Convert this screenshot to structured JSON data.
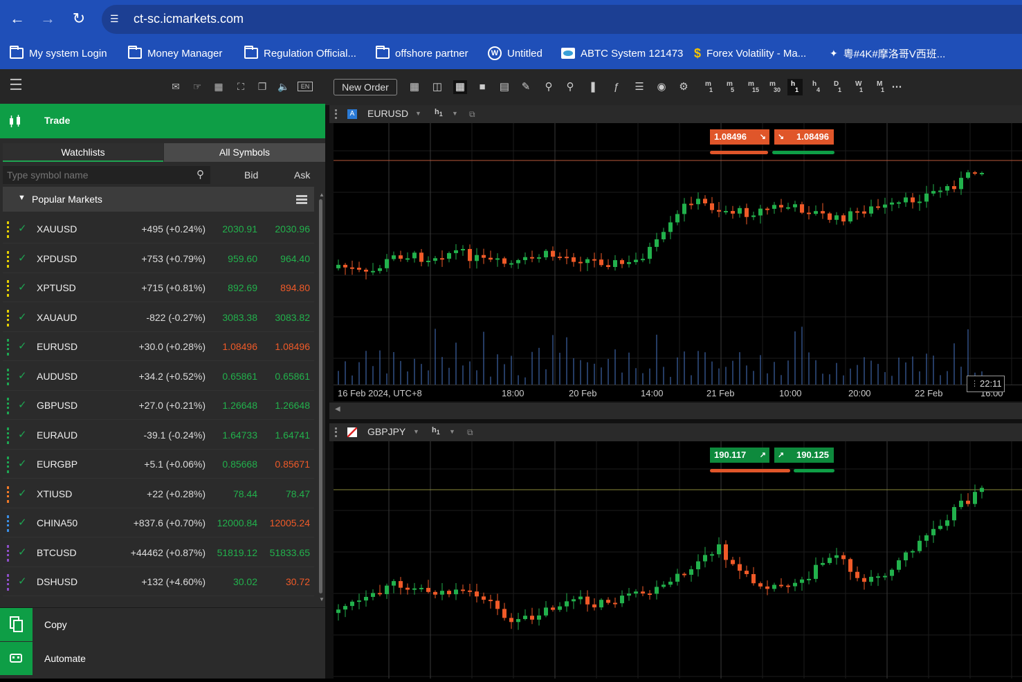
{
  "browser": {
    "url": "ct-sc.icmarkets.com",
    "bookmarks": [
      {
        "label": "My system Login",
        "icon": "folder-icon"
      },
      {
        "label": "Money Manager",
        "icon": "folder-icon"
      },
      {
        "label": "Regulation Official...",
        "icon": "folder-icon"
      },
      {
        "label": "offshore partner",
        "icon": "folder-icon"
      },
      {
        "label": "Untitled",
        "icon": "wordpress-icon"
      },
      {
        "label": "ABTC System 121473",
        "icon": "site-icon"
      },
      {
        "label": "Forex Volatility - Ma...",
        "icon": "dollar-icon"
      },
      {
        "label": "粵#4K#摩洛哥V西班...",
        "icon": "site-icon"
      }
    ]
  },
  "left_panel": {
    "trade_label": "Trade",
    "tabs": [
      "Watchlists",
      "All Symbols"
    ],
    "search_placeholder": "Type symbol name",
    "col_bid": "Bid",
    "col_ask": "Ask",
    "group_label": "Popular Markets",
    "symbols": [
      {
        "sym": "XAUUSD",
        "chg": "+495 (+0.24%)",
        "bid": "2030.91",
        "ask": "2030.96",
        "bid_dir": "up",
        "ask_dir": "up",
        "dot": "#e6d000"
      },
      {
        "sym": "XPDUSD",
        "chg": "+753 (+0.79%)",
        "bid": "959.60",
        "ask": "964.40",
        "bid_dir": "up",
        "ask_dir": "up",
        "dot": "#e6d000"
      },
      {
        "sym": "XPTUSD",
        "chg": "+715 (+0.81%)",
        "bid": "892.69",
        "ask": "894.80",
        "bid_dir": "up",
        "ask_dir": "dn",
        "dot": "#e6d000"
      },
      {
        "sym": "XAUAUD",
        "chg": "-822 (-0.27%)",
        "bid": "3083.38",
        "ask": "3083.82",
        "bid_dir": "up",
        "ask_dir": "up",
        "dot": "#e6d000"
      },
      {
        "sym": "EURUSD",
        "chg": "+30.0 (+0.28%)",
        "bid": "1.08496",
        "ask": "1.08496",
        "bid_dir": "dn",
        "ask_dir": "dn",
        "dot": "#1ea552"
      },
      {
        "sym": "AUDUSD",
        "chg": "+34.2 (+0.52%)",
        "bid": "0.65861",
        "ask": "0.65861",
        "bid_dir": "up",
        "ask_dir": "up",
        "dot": "#1ea552"
      },
      {
        "sym": "GBPUSD",
        "chg": "+27.0 (+0.21%)",
        "bid": "1.26648",
        "ask": "1.26648",
        "bid_dir": "up",
        "ask_dir": "up",
        "dot": "#1ea552"
      },
      {
        "sym": "EURAUD",
        "chg": "-39.1 (-0.24%)",
        "bid": "1.64733",
        "ask": "1.64741",
        "bid_dir": "up",
        "ask_dir": "up",
        "dot": "#1ea552"
      },
      {
        "sym": "EURGBP",
        "chg": "+5.1 (+0.06%)",
        "bid": "0.85668",
        "ask": "0.85671",
        "bid_dir": "up",
        "ask_dir": "dn",
        "dot": "#1ea552"
      },
      {
        "sym": "XTIUSD",
        "chg": "+22 (+0.28%)",
        "bid": "78.44",
        "ask": "78.47",
        "bid_dir": "up",
        "ask_dir": "up",
        "dot": "#f07a28"
      },
      {
        "sym": "CHINA50",
        "chg": "+837.6 (+0.70%)",
        "bid": "12000.84",
        "ask": "12005.24",
        "bid_dir": "up",
        "ask_dir": "dn",
        "dot": "#3b8fe6"
      },
      {
        "sym": "BTCUSD",
        "chg": "+44462 (+0.87%)",
        "bid": "51819.12",
        "ask": "51833.65",
        "bid_dir": "up",
        "ask_dir": "up",
        "dot": "#8e4fc9"
      },
      {
        "sym": "DSHUSD",
        "chg": "+132 (+4.60%)",
        "bid": "30.02",
        "ask": "30.72",
        "bid_dir": "up",
        "ask_dir": "dn",
        "dot": "#8e4fc9"
      }
    ],
    "bottom_items": [
      "Copy",
      "Automate"
    ]
  },
  "chart_toolbar": {
    "new_order": "New Order",
    "timeframes": [
      {
        "l": "m",
        "s": "1"
      },
      {
        "l": "m",
        "s": "5"
      },
      {
        "l": "m",
        "s": "15"
      },
      {
        "l": "m",
        "s": "30"
      },
      {
        "l": "h",
        "s": "1",
        "active": true
      },
      {
        "l": "h",
        "s": "4"
      },
      {
        "l": "D",
        "s": "1"
      },
      {
        "l": "W",
        "s": "1"
      },
      {
        "l": "M",
        "s": "1"
      }
    ]
  },
  "chart1": {
    "symbol": "EURUSD",
    "badge": "A",
    "timeframe": "h",
    "timeframe_sub": "1",
    "sell_price": "1.08496",
    "buy_price": "1.08496",
    "time_labels": [
      "16 Feb 2024, UTC+8",
      "18:00",
      "20 Feb",
      "14:00",
      "21 Feb",
      "10:00",
      "20:00",
      "22 Feb",
      "16:00"
    ],
    "countdown": "22:11"
  },
  "chart2": {
    "symbol": "GBPJPY",
    "timeframe": "h",
    "timeframe_sub": "1",
    "sell_price": "190.117",
    "buy_price": "190.125"
  },
  "colors": {
    "up": "#22b14c",
    "down": "#f05a28",
    "brand_green": "#0e9e46",
    "browser_blue": "#1f4fb8"
  }
}
